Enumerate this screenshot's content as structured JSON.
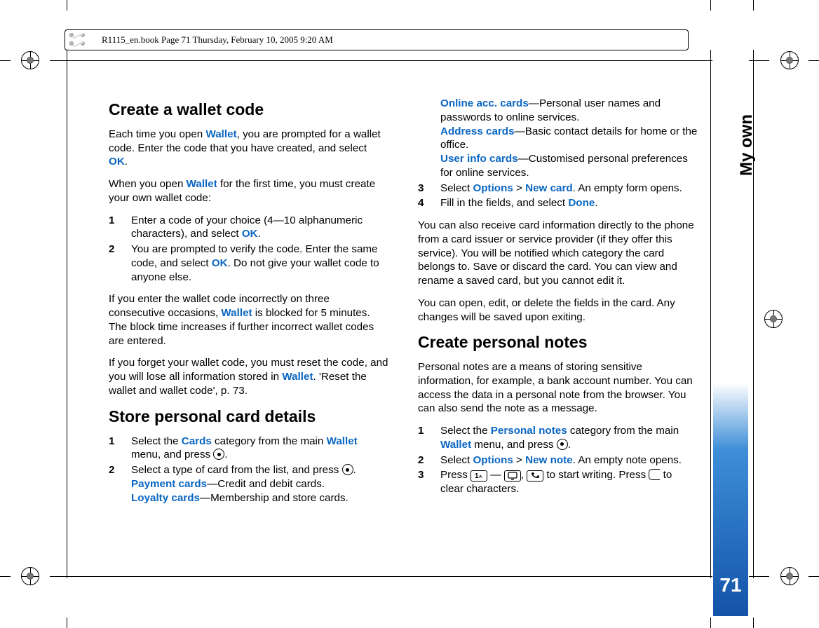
{
  "meta": {
    "text": "R1115_en.book  Page 71  Thursday, February 10, 2005  9:20 AM"
  },
  "sidebar": {
    "section": "My own",
    "page": "71"
  },
  "left": {
    "h_create": "Create a wallet code",
    "p1a": "Each time you open ",
    "p1b": "Wallet",
    "p1c": ", you are prompted for a wallet code. Enter the code that you have created, and select ",
    "p1d": "OK",
    "p1e": ".",
    "p2a": "When you open ",
    "p2b": "Wallet",
    "p2c": " for the first time, you must create your own wallet code:",
    "l1a": "Enter a code of your choice (4—10 alphanumeric characters), and select ",
    "l1b": "OK",
    "l1c": ".",
    "l2a": "You are prompted to verify the code. Enter the same code, and select ",
    "l2b": "OK",
    "l2c": ". Do not give your wallet code to anyone else.",
    "p3a": "If you enter the wallet code incorrectly on three consecutive occasions, ",
    "p3b": "Wallet",
    "p3c": " is blocked for 5 minutes. The block time increases if further incorrect wallet codes are entered.",
    "p4a": "If you forget your wallet code, you must reset the code, and you will lose all information stored in ",
    "p4b": "Wallet",
    "p4c": ". 'Reset the wallet and wallet code', p. 73.",
    "h_store": "Store personal card details",
    "s1a": "Select the ",
    "s1b": "Cards",
    "s1c": " category from the main ",
    "s1d": "Wallet",
    "s1e": " menu, and press ",
    "s2a": "Select a type of card from the list, and press ",
    "s2b": "Payment cards",
    "s2c": "—Credit and debit cards.",
    "s2d": "Loyalty cards",
    "s2e": "—Membership and store cards."
  },
  "right": {
    "r1a": "Online acc. cards",
    "r1b": "—Personal user names and passwords to online services.",
    "r1c": "Address cards",
    "r1d": "—Basic contact details for home or the office.",
    "r1e": "User info cards",
    "r1f": "—Customised personal preferences for online services.",
    "r3a": "Select ",
    "r3b": "Options",
    "r3c": " > ",
    "r3d": "New card",
    "r3e": ". An empty form opens.",
    "r4a": "Fill in the fields, and select ",
    "r4b": "Done",
    "r4c": ".",
    "p5": "You can also receive card information directly to the phone from a card issuer or service provider (if they offer this service). You will be notified which category the card belongs to. Save or discard the card. You can view and rename a saved card, but you cannot edit it.",
    "p6": "You can open, edit, or delete the fields in the card. Any changes will be saved upon exiting.",
    "h_notes": "Create personal notes",
    "p7": "Personal notes are a means of storing sensitive information, for example, a bank account number. You can access the data in a personal note from the browser. You can also send the note as a message.",
    "n1a": "Select the ",
    "n1b": "Personal notes",
    "n1c": " category from the main ",
    "n1d": "Wallet",
    "n1e": " menu, and press ",
    "n2a": "Select ",
    "n2b": "Options",
    "n2c": " > ",
    "n2d": "New note",
    "n2e": ". An empty note opens.",
    "n3a": "Press ",
    "n3b": " — ",
    "n3c": " to start writing. Press ",
    "n3d": " to clear characters."
  }
}
